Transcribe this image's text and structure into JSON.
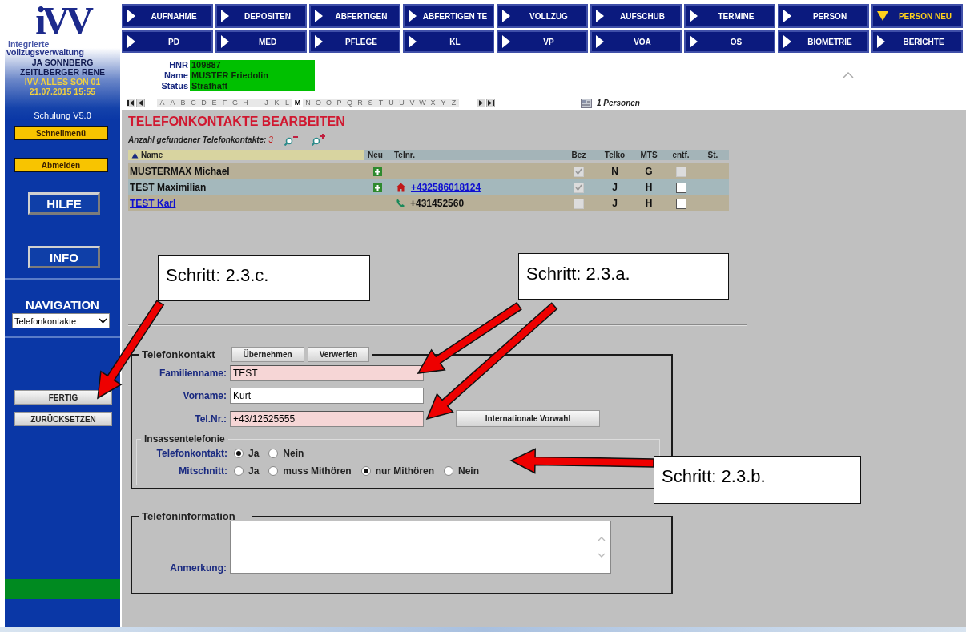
{
  "logo": {
    "mark": "iVV",
    "line_1": "integrierte",
    "line_2": "vollzugsverwaltung"
  },
  "user": {
    "names": [
      "JA SONNBERG",
      "ZEITLBERGER RENE"
    ],
    "session": "IVV-ALLES SON 01",
    "timestamp": "21.07.2015 15:55"
  },
  "sidebar": {
    "version": "Schulung V5.0",
    "buttons": [
      {
        "label": "Schnellmenü",
        "kind": "quick"
      },
      {
        "label": "Abmelden",
        "kind": "quick"
      },
      {
        "label": "HILFE",
        "kind": "big"
      },
      {
        "label": "INFO",
        "kind": "big"
      }
    ],
    "navigation_heading": "NAVIGATION",
    "navigation_value": "Telefonkontakte",
    "actions": [
      "FERTIG",
      "ZURÜCKSETZEN"
    ]
  },
  "nav": [
    {
      "label": "AUFNAHME",
      "expanded": false
    },
    {
      "label": "DEPOSITEN",
      "expanded": false
    },
    {
      "label": "ABFERTIGEN",
      "expanded": false
    },
    {
      "label": "ABFERTIGEN TE",
      "expanded": false
    },
    {
      "label": "VOLLZUG",
      "expanded": false
    },
    {
      "label": "AUFSCHUB",
      "expanded": false
    },
    {
      "label": "TERMINE",
      "expanded": false
    },
    {
      "label": "PERSON",
      "expanded": false
    },
    {
      "label": "PERSON NEU",
      "expanded": true
    },
    {
      "label": "PD",
      "expanded": false
    },
    {
      "label": "MED",
      "expanded": false
    },
    {
      "label": "PFLEGE",
      "expanded": false
    },
    {
      "label": "KL",
      "expanded": false
    },
    {
      "label": "VP",
      "expanded": false
    },
    {
      "label": "VOÄ",
      "expanded": false
    },
    {
      "label": "OS",
      "expanded": false
    },
    {
      "label": "BIOMETRIE",
      "expanded": false
    },
    {
      "label": "BERICHTE",
      "expanded": false
    }
  ],
  "patient": [
    {
      "label": "HNR",
      "value": "109887"
    },
    {
      "label": "Name",
      "value": "MUSTER Friedolin"
    },
    {
      "label": "Status",
      "value": "Strafhaft"
    }
  ],
  "alphabet": [
    {
      "letter": "A",
      "selected": false
    },
    {
      "letter": "Ä",
      "selected": false
    },
    {
      "letter": "B",
      "selected": false
    },
    {
      "letter": "C",
      "selected": false
    },
    {
      "letter": "D",
      "selected": false
    },
    {
      "letter": "E",
      "selected": false
    },
    {
      "letter": "F",
      "selected": false
    },
    {
      "letter": "G",
      "selected": false
    },
    {
      "letter": "H",
      "selected": false
    },
    {
      "letter": "I",
      "selected": false
    },
    {
      "letter": "J",
      "selected": false
    },
    {
      "letter": "K",
      "selected": false
    },
    {
      "letter": "L",
      "selected": false
    },
    {
      "letter": "M",
      "selected": true
    },
    {
      "letter": "N",
      "selected": false
    },
    {
      "letter": "O",
      "selected": false
    },
    {
      "letter": "Ö",
      "selected": false
    },
    {
      "letter": "P",
      "selected": false
    },
    {
      "letter": "Q",
      "selected": false
    },
    {
      "letter": "R",
      "selected": false
    },
    {
      "letter": "S",
      "selected": false
    },
    {
      "letter": "T",
      "selected": false
    },
    {
      "letter": "U",
      "selected": false
    },
    {
      "letter": "Ü",
      "selected": false
    },
    {
      "letter": "V",
      "selected": false
    },
    {
      "letter": "W",
      "selected": false
    },
    {
      "letter": "X",
      "selected": false
    },
    {
      "letter": "Y",
      "selected": false
    },
    {
      "letter": "Z",
      "selected": false
    }
  ],
  "persons_count": "1 Personen",
  "contacts": {
    "title": "TELEFONKONTAKTE BEARBEITEN",
    "count_label": "Anzahl gefundener Telefonkontakte:",
    "count": "3",
    "columns": [
      {
        "label": "Name",
        "sorted": true
      },
      {
        "label": "Neu",
        "sorted": false
      },
      {
        "label": "Telnr.",
        "sorted": false
      },
      {
        "label": "Bez",
        "sorted": false
      },
      {
        "label": "Telko",
        "sorted": false
      },
      {
        "label": "MTS",
        "sorted": false
      },
      {
        "label": "entf.",
        "sorted": false
      },
      {
        "label": "St.",
        "sorted": false
      }
    ],
    "rows": [
      {
        "name": "MUSTERMAX Michael",
        "link": false,
        "can_add": true,
        "bez": {
          "checked": true,
          "disabled": true
        },
        "telko": "N",
        "mts": "G",
        "entf": {
          "checked": false,
          "disabled": true
        }
      },
      {
        "name": "TEST Maximilian",
        "link": false,
        "can_add": true,
        "phone": {
          "kind": "home",
          "number": "+432586018124",
          "link": true
        },
        "bez": {
          "checked": true,
          "disabled": true
        },
        "telko": "J",
        "mts": "H",
        "entf": {
          "checked": false,
          "disabled": false
        }
      },
      {
        "name": "TEST Karl",
        "link": true,
        "can_add": false,
        "phone": {
          "kind": "handset",
          "number": "+431452560",
          "link": false
        },
        "bez": {
          "checked": false,
          "disabled": true
        },
        "telko": "J",
        "mts": "H",
        "entf": {
          "checked": false,
          "disabled": false
        }
      }
    ]
  },
  "contact_form": {
    "legend": "Telefonkontakt",
    "buttons": [
      "Übernehmen",
      "Verwerfen"
    ],
    "fields": [
      {
        "label": "Familienname:",
        "value": "TEST",
        "required": true
      },
      {
        "label": "Vorname:",
        "value": "Kurt",
        "required": false
      },
      {
        "label": "Tel.Nr.:",
        "value": "+43/12525555",
        "required": true
      }
    ],
    "intl_button": "Internationale Vorwahl",
    "inmate": {
      "legend": "Insassentelefonie",
      "groups": [
        {
          "label": "Telefonkontakt:",
          "options": [
            {
              "label": "Ja",
              "selected": true
            },
            {
              "label": "Nein",
              "selected": false
            }
          ]
        },
        {
          "label": "Mitschnitt:",
          "options": [
            {
              "label": "Ja",
              "selected": false
            },
            {
              "label": "muss Mithören",
              "selected": false
            },
            {
              "label": "nur Mithören",
              "selected": true
            },
            {
              "label": "Nein",
              "selected": false
            }
          ]
        }
      ]
    }
  },
  "info_form": {
    "legend": "Telefoninformation",
    "label": "Anmerkung:"
  },
  "callouts": [
    {
      "text": "Schritt: 2.3.c."
    },
    {
      "text": "Schritt: 2.3.a."
    },
    {
      "text": "Schritt: 2.3.b."
    }
  ]
}
